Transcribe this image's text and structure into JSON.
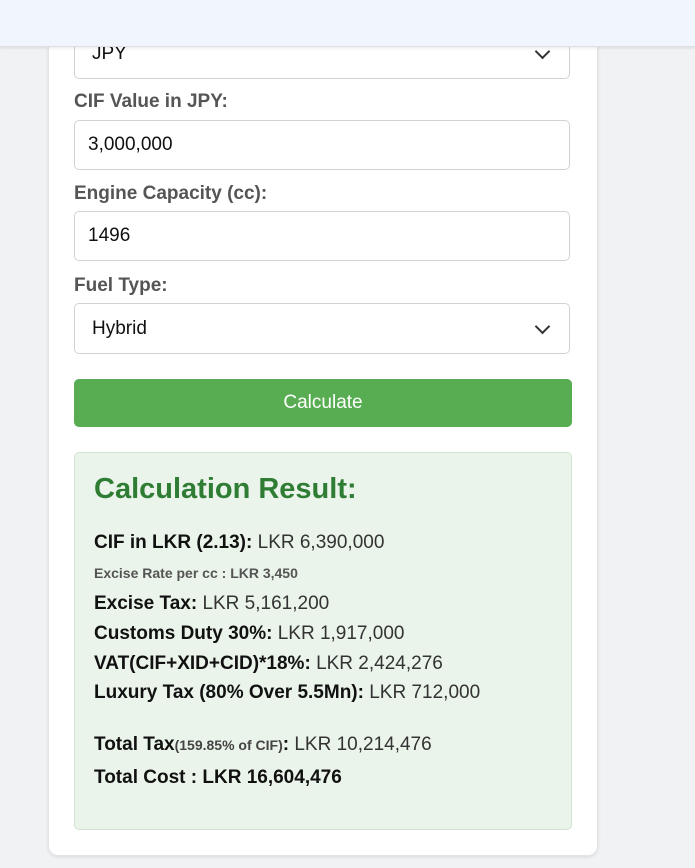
{
  "form": {
    "currency": {
      "value": "JPY"
    },
    "cif": {
      "label": "CIF Value in JPY:",
      "value": "3,000,000"
    },
    "engine": {
      "label": "Engine Capacity (cc):",
      "value": "1496"
    },
    "fuel": {
      "label": "Fuel Type:",
      "value": "Hybrid"
    },
    "calculate_label": "Calculate"
  },
  "result": {
    "title": "Calculation Result:",
    "cif_lkr": {
      "label": "CIF in LKR (2.13):",
      "value": "LKR 6,390,000"
    },
    "excise_rate": {
      "label": "Excise Rate per cc :",
      "value": "LKR 3,450"
    },
    "excise_tax": {
      "label": "Excise Tax:",
      "value": "LKR 5,161,200"
    },
    "customs_duty": {
      "label": "Customs Duty 30%:",
      "value": "LKR 1,917,000"
    },
    "vat": {
      "label": "VAT(CIF+XID+CID)*18%:",
      "value": "LKR 2,424,276"
    },
    "luxury_tax": {
      "label": "Luxury Tax (80% Over 5.5Mn):",
      "value": "LKR 712,000"
    },
    "total_tax": {
      "label": "Total Tax",
      "note": "(159.85% of CIF)",
      "value": "LKR 10,214,476"
    },
    "total_cost": {
      "label": "Total Cost :",
      "value": "LKR 16,604,476"
    }
  },
  "colors": {
    "accent": "#58ad52",
    "result_title": "#2f7d34",
    "result_bg": "#eaf4ea"
  }
}
